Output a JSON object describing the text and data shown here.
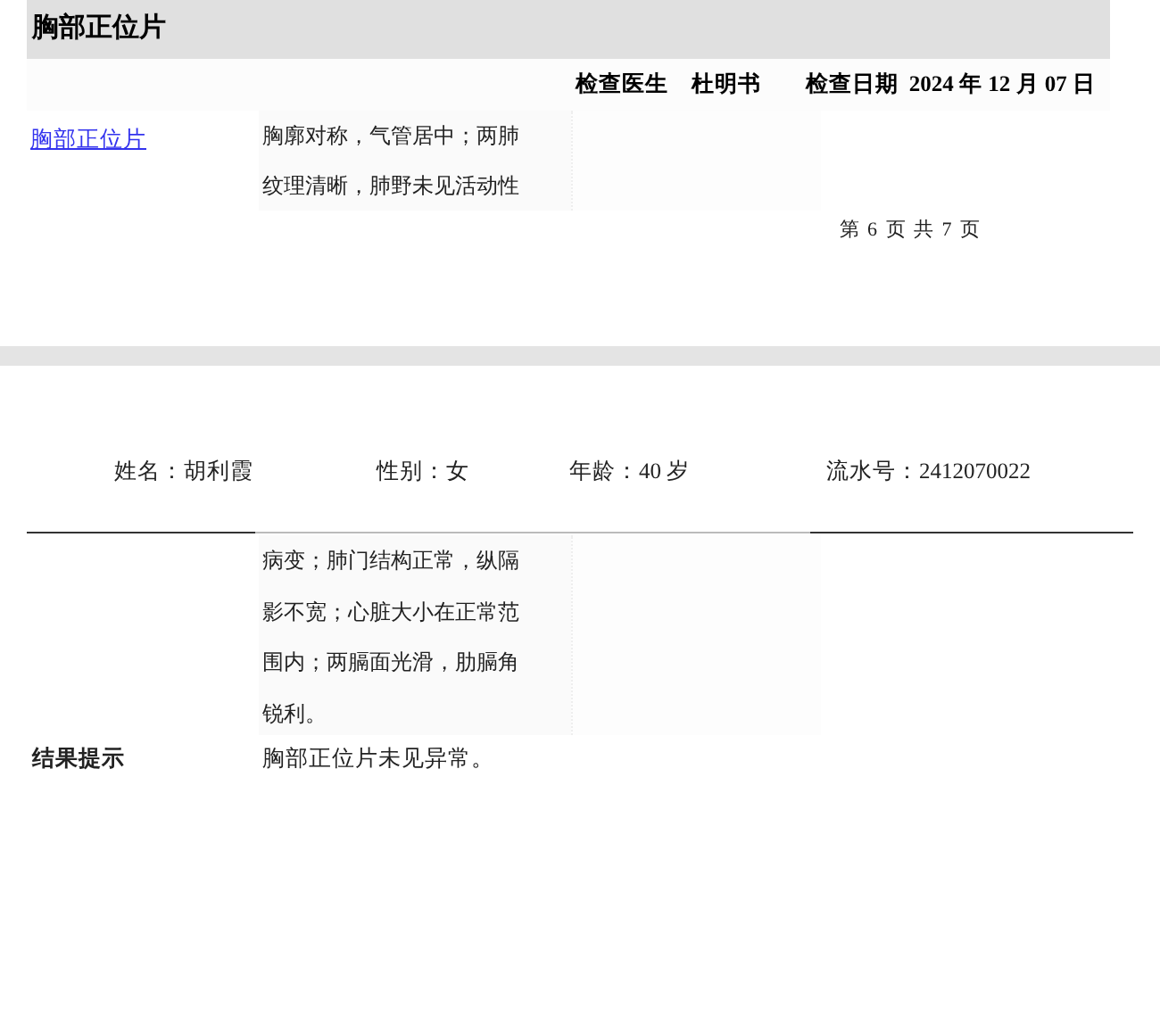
{
  "page_1": {
    "section_title": "胸部正位片",
    "doctor_label": "检查医生",
    "doctor": "杜明书",
    "date_label": "检查日期",
    "date": "2024 年 12 月 07 日",
    "item_link": "胸部正位片",
    "findings": "胸廓对称，气管居中；两肺纹理清晰，肺野未见活动性",
    "page_indicator": "第 6 页 共 7 页"
  },
  "page_2": {
    "patient_fields": [
      "姓名：胡利霞",
      "性别：女",
      "年龄：40 岁",
      "流水号：2412070022"
    ],
    "findings_continued": "病变；肺门结构正常，纵隔影不宽；心脏大小在正常范围内；两膈面光滑，肋膈角锐利。",
    "result_label": "结果提示",
    "result": "胸部正位片未见异常。"
  }
}
